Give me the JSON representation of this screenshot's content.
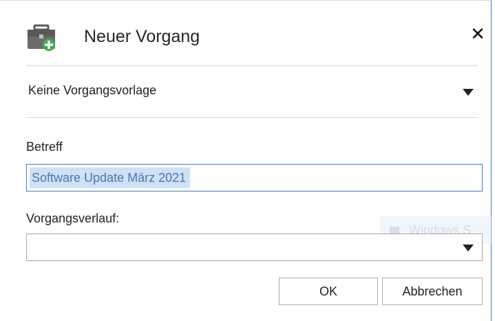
{
  "dialog": {
    "title": "Neuer Vorgang",
    "close_icon": "close-icon",
    "app_icon": "briefcase-add-icon"
  },
  "template": {
    "selected": "Keine Vorgangsvorlage"
  },
  "subject": {
    "label": "Betreff",
    "value": "Software Update März 2021"
  },
  "history": {
    "label": "Vorgangsverlauf:",
    "value": ""
  },
  "watermark": {
    "text": "Windows S"
  },
  "buttons": {
    "ok": "OK",
    "cancel": "Abbrechen"
  },
  "colors": {
    "focus_border": "#3a7bd5",
    "selection": "#cfe1f7",
    "icon_green": "#3bb04a"
  }
}
